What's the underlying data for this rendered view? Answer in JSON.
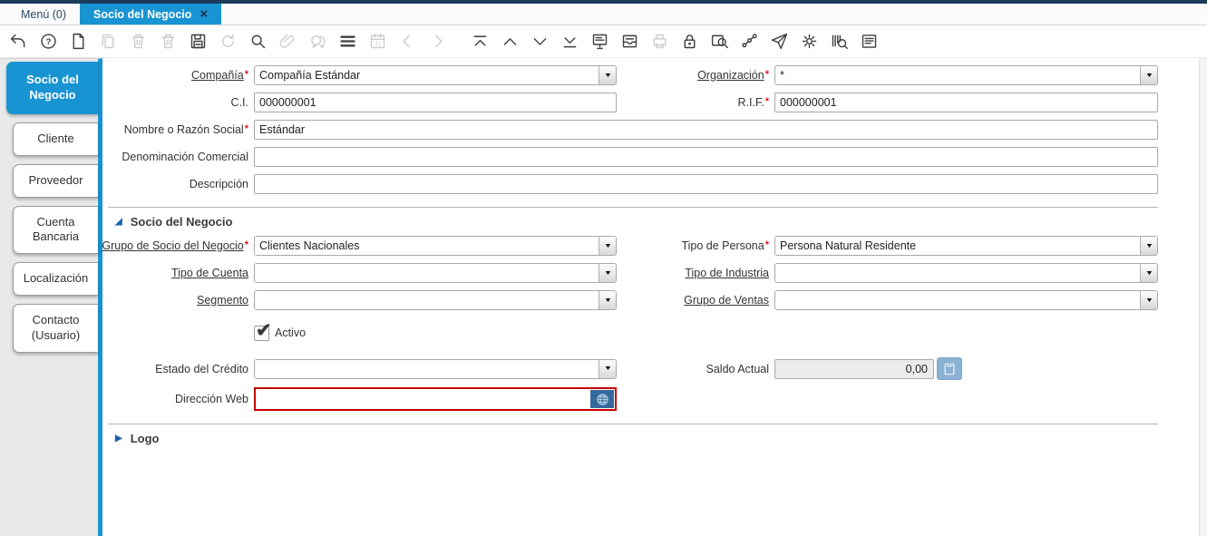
{
  "misc": {
    "required_marker": "*",
    "dropdown_glyph": "▼",
    "checkbox_glyph": "✔",
    "triangle_expanded": "◢",
    "triangle_collapsed": "▶"
  },
  "colors": {
    "accent_blue": "#1994d2",
    "top_bar": "#1b3a5c",
    "required_red": "#e01414",
    "focus_red": "#c40000",
    "globe_button": "#35699b",
    "calc_button": "#8cb2d3"
  },
  "window_tabs": {
    "menu": {
      "label": "Menú (0)"
    },
    "active": {
      "label": "Socio del Negocio",
      "close_glyph": "×"
    }
  },
  "toolbar": {
    "items": [
      {
        "name": "undo",
        "enabled": true
      },
      {
        "name": "help",
        "enabled": true
      },
      {
        "name": "new-record",
        "enabled": true
      },
      {
        "name": "copy-record",
        "enabled": false
      },
      {
        "name": "delete-record",
        "enabled": false
      },
      {
        "name": "delete-selection",
        "enabled": false
      },
      {
        "name": "save",
        "enabled": true
      },
      {
        "name": "refresh",
        "enabled": false
      },
      {
        "name": "find",
        "enabled": true
      },
      {
        "name": "attachment",
        "enabled": false
      },
      {
        "name": "chat",
        "enabled": false
      },
      {
        "name": "grid-toggle",
        "enabled": true
      },
      {
        "name": "requests",
        "enabled": false
      },
      {
        "name": "parent-record",
        "enabled": false
      },
      {
        "name": "detail-record",
        "enabled": false
      },
      {
        "name": "first-record",
        "enabled": true,
        "gap": true
      },
      {
        "name": "previous-record",
        "enabled": true
      },
      {
        "name": "next-record",
        "enabled": true
      },
      {
        "name": "last-record",
        "enabled": true
      },
      {
        "name": "report",
        "enabled": true
      },
      {
        "name": "archive",
        "enabled": true
      },
      {
        "name": "print",
        "enabled": false
      },
      {
        "name": "lock",
        "enabled": true
      },
      {
        "name": "zoom-across",
        "enabled": true
      },
      {
        "name": "workflow",
        "enabled": true
      },
      {
        "name": "share",
        "enabled": true
      },
      {
        "name": "preferences",
        "enabled": true
      },
      {
        "name": "product-info",
        "enabled": true
      },
      {
        "name": "quick-form",
        "enabled": true
      }
    ]
  },
  "sidebar": {
    "tabs": [
      {
        "label": "Socio del Negocio",
        "active": true
      },
      {
        "label": "Cliente",
        "active": false
      },
      {
        "label": "Proveedor",
        "active": false
      },
      {
        "label": "Cuenta Bancaria",
        "active": false
      },
      {
        "label": "Localización",
        "active": false
      },
      {
        "label": "Contacto (Usuario)",
        "active": false
      }
    ]
  },
  "form": {
    "compania": {
      "label": "Compañía",
      "value": "Compañía Estándar"
    },
    "organizacion": {
      "label": "Organización",
      "value": "*"
    },
    "ci": {
      "label": "C.I.",
      "value": "000000001"
    },
    "rif": {
      "label": "R.I.F.",
      "value": "000000001"
    },
    "nombre": {
      "label": "Nombre o Razón Social",
      "value": "Estándar"
    },
    "denominacion": {
      "label": "Denominación Comercial",
      "value": ""
    },
    "descripcion": {
      "label": "Descripción",
      "value": ""
    },
    "section_socio": {
      "title": "Socio del Negocio"
    },
    "grupo_socio": {
      "label": "Grupo de Socio del Negocio",
      "value": "Clientes Nacionales"
    },
    "tipo_persona": {
      "label": "Tipo de Persona",
      "value": "Persona Natural Residente"
    },
    "tipo_cuenta": {
      "label": "Tipo de Cuenta",
      "value": ""
    },
    "tipo_industria": {
      "label": "Tipo de Industria",
      "value": ""
    },
    "segmento": {
      "label": "Segmento",
      "value": ""
    },
    "grupo_ventas": {
      "label": "Grupo de Ventas",
      "value": ""
    },
    "activo": {
      "label": "Activo",
      "checked": true
    },
    "estado_credito": {
      "label": "Estado del Crédito",
      "value": ""
    },
    "saldo_actual": {
      "label": "Saldo Actual",
      "value": "0,00"
    },
    "direccion_web": {
      "label": "Dirección Web",
      "value": ""
    },
    "section_logo": {
      "title": "Logo"
    }
  }
}
